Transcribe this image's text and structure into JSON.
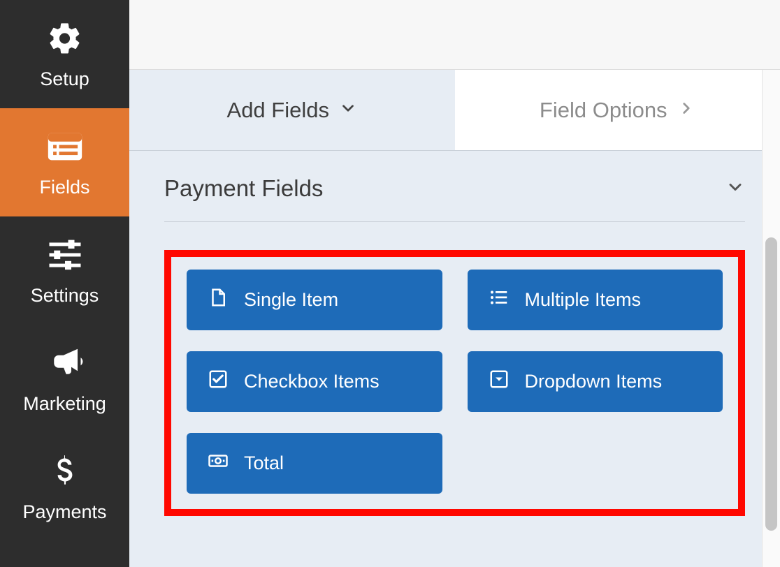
{
  "sidebar": {
    "items": [
      {
        "label": "Setup"
      },
      {
        "label": "Fields"
      },
      {
        "label": "Settings"
      },
      {
        "label": "Marketing"
      },
      {
        "label": "Payments"
      }
    ]
  },
  "tabs": {
    "add_fields_label": "Add Fields",
    "field_options_label": "Field Options"
  },
  "section": {
    "title": "Payment Fields"
  },
  "fields": {
    "single_item": "Single Item",
    "multiple_items": "Multiple Items",
    "checkbox_items": "Checkbox Items",
    "dropdown_items": "Dropdown Items",
    "total": "Total"
  },
  "colors": {
    "accent": "#e27730",
    "button": "#1e6bb8",
    "highlight": "#ff0800"
  }
}
